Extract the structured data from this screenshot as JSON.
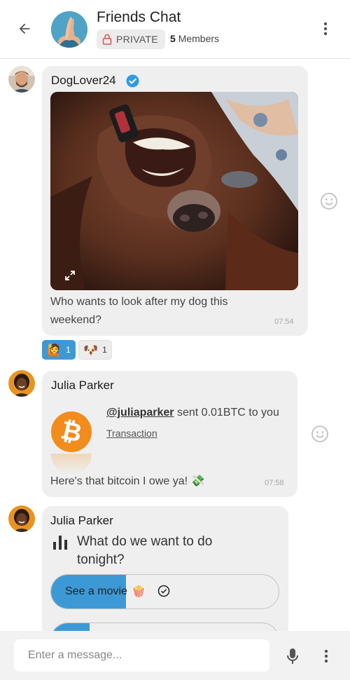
{
  "header": {
    "title": "Friends Chat",
    "privacy_label": "PRIVATE",
    "member_count": "5",
    "member_suffix": "Members",
    "icons": {
      "back": "arrow-left-icon",
      "menu": "more-vert-icon",
      "lock": "lock-icon"
    }
  },
  "messages": [
    {
      "sender": "DogLover24",
      "verified": true,
      "image": "dog-photo",
      "text": "Who wants to look after my dog this weekend?",
      "time": "07:54",
      "reactions": [
        {
          "emoji": "🙋",
          "count": "1",
          "active": true
        },
        {
          "emoji": "🐶",
          "count": "1",
          "active": false
        }
      ]
    },
    {
      "sender": "Julia Parker",
      "payment": {
        "user": "@juliaparker",
        "action": "sent 0.01BTC to you",
        "link": "Transaction"
      },
      "text": "Here's that bitcoin I owe ya!",
      "text_emoji": "💸",
      "time": "07:58"
    },
    {
      "sender": "Julia Parker",
      "poll": {
        "question": "What do we want to do tonight?",
        "options": [
          {
            "label": "See a movie",
            "emoji": "🍿",
            "fraction": 0.33,
            "selected": true
          },
          {
            "label": "",
            "emoji": "",
            "fraction": 0.17,
            "selected": false
          }
        ]
      }
    }
  ],
  "composer": {
    "placeholder": "Enter a message...",
    "icons": {
      "mic": "mic-icon",
      "menu": "more-vert-icon"
    }
  },
  "colors": {
    "accent": "#3d99d6",
    "bitcoin": "#f28c1c",
    "verified": "#2f9be4",
    "bubble": "#efefef",
    "lock": "#e0524a"
  }
}
